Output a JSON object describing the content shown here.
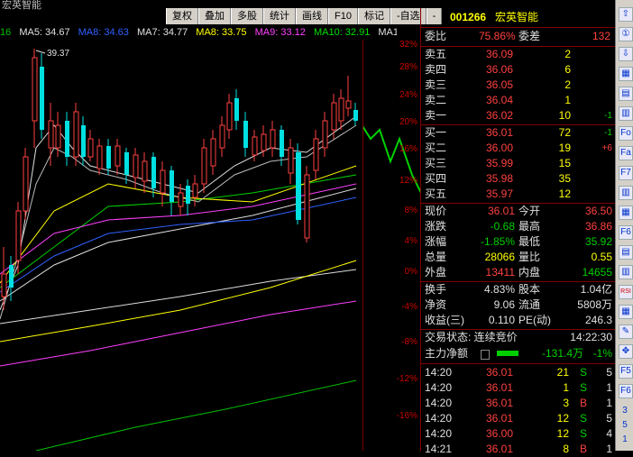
{
  "window_title": "宏英智能",
  "toolbar": [
    "复权",
    "叠加",
    "多股",
    "统计",
    "画线",
    "F10",
    "标记",
    "-自选",
    "-"
  ],
  "ma_row": [
    {
      "label": "16",
      "color": "#00c000"
    },
    {
      "label": "MA5: 34.67",
      "color": "#e0e0e0"
    },
    {
      "label": "MA8: 34.63",
      "color": "#3060ff"
    },
    {
      "label": "MA7: 34.77",
      "color": "#e0e0e0"
    },
    {
      "label": "MA8: 33.75",
      "color": "#ffff00"
    },
    {
      "label": "MA9: 33.12",
      "color": "#ff40ff"
    },
    {
      "label": "MA10: 32.91",
      "color": "#00e000"
    },
    {
      "label": "MA1 ◇",
      "color": "#e0e0e0"
    }
  ],
  "peak_label": "39.37",
  "axis_ticks": [
    "32%",
    "28%",
    "24%",
    "20%",
    "16%",
    "12%",
    "8%",
    "4%",
    "0%",
    "-4%",
    "-8%",
    "-12%",
    "-16%"
  ],
  "stock": {
    "code": "001266",
    "name": "宏英智能"
  },
  "ratio": {
    "label1": "委比",
    "value1": "75.86%",
    "label2": "委差",
    "value2": "132"
  },
  "asks": [
    {
      "label": "卖五",
      "price": "36.09",
      "vol": "2",
      "chg": ""
    },
    {
      "label": "卖四",
      "price": "36.06",
      "vol": "6",
      "chg": ""
    },
    {
      "label": "卖三",
      "price": "36.05",
      "vol": "2",
      "chg": ""
    },
    {
      "label": "卖二",
      "price": "36.04",
      "vol": "1",
      "chg": ""
    },
    {
      "label": "卖一",
      "price": "36.02",
      "vol": "10",
      "chg": "-1"
    }
  ],
  "bids": [
    {
      "label": "买一",
      "price": "36.01",
      "vol": "72",
      "chg": "-1"
    },
    {
      "label": "买二",
      "price": "36.00",
      "vol": "19",
      "chg": "+6"
    },
    {
      "label": "买三",
      "price": "35.99",
      "vol": "15",
      "chg": ""
    },
    {
      "label": "买四",
      "price": "35.98",
      "vol": "35",
      "chg": ""
    },
    {
      "label": "买五",
      "price": "35.97",
      "vol": "12",
      "chg": ""
    }
  ],
  "quote": [
    {
      "l1": "现价",
      "v1": "36.01",
      "l2": "今开",
      "v2": "36.50",
      "c1": "#ff4040",
      "c2": "#ff4040"
    },
    {
      "l1": "涨跌",
      "v1": "-0.68",
      "l2": "最高",
      "v2": "36.86",
      "c1": "#00d000",
      "c2": "#ff4040"
    },
    {
      "l1": "涨幅",
      "v1": "-1.85%",
      "l2": "最低",
      "v2": "35.92",
      "c1": "#00d000",
      "c2": "#00d000"
    },
    {
      "l1": "总量",
      "v1": "28066",
      "l2": "量比",
      "v2": "0.55",
      "c1": "#ffff00",
      "c2": "#ffff00"
    },
    {
      "l1": "外盘",
      "v1": "13411",
      "l2": "内盘",
      "v2": "14655",
      "c1": "#ff4040",
      "c2": "#00d000"
    }
  ],
  "fundamentals": [
    {
      "l1": "换手",
      "v1": "4.83%",
      "l2": "股本",
      "v2": "1.04亿"
    },
    {
      "l1": "净资",
      "v1": "9.06",
      "l2": "流通",
      "v2": "5808万"
    },
    {
      "l1": "收益(三)",
      "v1": "0.110",
      "l2": "PE(动)",
      "v2": "246.3"
    }
  ],
  "status": {
    "label": "交易状态: 连续竞价",
    "time": "14:22:30"
  },
  "main_flow": {
    "label": "主力净额",
    "value": "-131.4万",
    "pct": "-1%"
  },
  "ticks": [
    {
      "time": "14:20",
      "price": "36.01",
      "vol": "21",
      "dir": "S",
      "n": "5"
    },
    {
      "time": "14:20",
      "price": "36.01",
      "vol": "1",
      "dir": "S",
      "n": "1"
    },
    {
      "time": "14:20",
      "price": "36.01",
      "vol": "3",
      "dir": "B",
      "n": "1"
    },
    {
      "time": "14:20",
      "price": "36.01",
      "vol": "12",
      "dir": "S",
      "n": "5"
    },
    {
      "time": "14:20",
      "price": "36.00",
      "vol": "12",
      "dir": "S",
      "n": "4"
    },
    {
      "time": "14:21",
      "price": "36.01",
      "vol": "8",
      "dir": "B",
      "n": "1"
    }
  ],
  "right_toolbar": [
    "⇧",
    "①",
    "⇩",
    "▦",
    "▤",
    "▥",
    "Fo",
    "Fa",
    "F7",
    "▥",
    "▦",
    "F6",
    "▤",
    "▥",
    "RSI",
    "▦",
    "✎",
    "✥",
    "F5",
    "F6"
  ],
  "right_numbers": [
    "3",
    "5",
    "1"
  ]
}
